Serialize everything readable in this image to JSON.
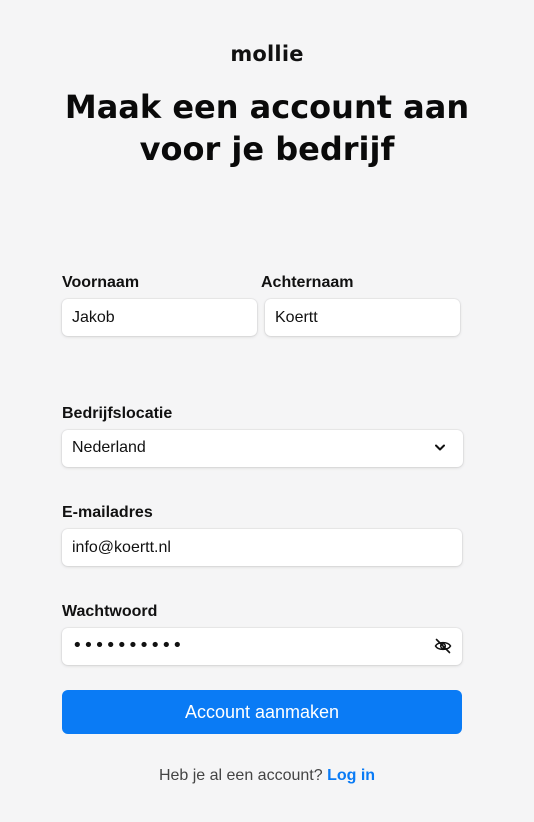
{
  "brand": {
    "logo_text": "mollie"
  },
  "heading": {
    "line1": "Maak een account aan",
    "line2": "voor je bedrijf"
  },
  "form": {
    "first_name": {
      "label": "Voornaam",
      "value": "Jakob"
    },
    "last_name": {
      "label": "Achternaam",
      "value": "Koertt"
    },
    "location": {
      "label": "Bedrijfslocatie",
      "value": "Nederland",
      "icon": "chevron-down-icon"
    },
    "email": {
      "label": "E-mailadres",
      "value": "info@koertt.nl"
    },
    "password": {
      "label": "Wachtwoord",
      "masked_value": "••••••••••",
      "icon": "eye-off-icon"
    },
    "submit_label": "Account aanmaken"
  },
  "footer": {
    "prompt": "Heb je al een account?",
    "login_label": "Log in"
  },
  "colors": {
    "accent": "#0a7bf5",
    "background": "#f5f5f6"
  }
}
